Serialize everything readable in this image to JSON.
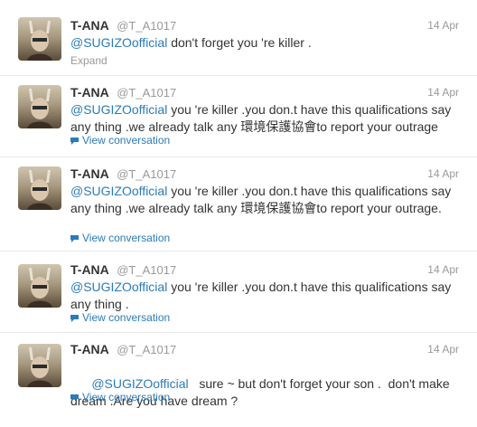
{
  "tweets": [
    {
      "fullname": "T-ANA",
      "screenname": "@T_A1017",
      "time": "14 Apr",
      "mention": "@SUGIZOofficial",
      "text": " don't forget you 're killer .",
      "action": "Expand"
    },
    {
      "fullname": "T-ANA",
      "screenname": "@T_A1017",
      "time": "14 Apr",
      "mention": "@SUGIZOofficial",
      "text": " you 're killer .you don.t have this qualifications say any thing .we already talk any 環境保護協會to report your outrage",
      "action": "View conversation"
    },
    {
      "fullname": "T-ANA",
      "screenname": "@T_A1017",
      "time": "14 Apr",
      "mention": "@SUGIZOofficial",
      "text": " you 're killer .you don.t have this qualifications say any thing .we already talk any 環境保護協會to report your outrage.",
      "action": "View conversation"
    },
    {
      "fullname": "T-ANA",
      "screenname": "@T_A1017",
      "time": "14 Apr",
      "mention": "@SUGIZOofficial",
      "text": " you 're killer .you don.t have this qualifications say any thing .",
      "action": "View conversation"
    },
    {
      "fullname": "T-ANA",
      "screenname": "@T_A1017",
      "time": "14 Apr",
      "mention": "@SUGIZOofficial",
      "text": "   sure ~ but don't forget your son .  don't make dream .Are you have dream ?",
      "action": "View conversation"
    }
  ]
}
